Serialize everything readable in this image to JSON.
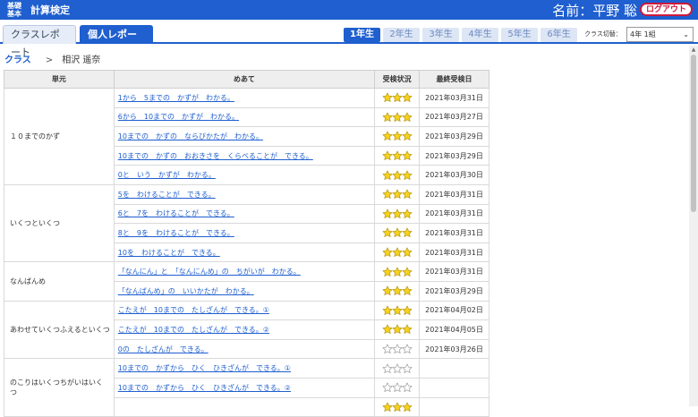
{
  "header": {
    "logo_line1": "基礎",
    "logo_line2": "基本",
    "app_title": "計算検定",
    "user_name": "名前：平野 聡",
    "logout_label": "ログアウト"
  },
  "tabs": [
    {
      "label": "クラスレポート",
      "active": false
    },
    {
      "label": "個人レポート",
      "active": true
    }
  ],
  "grade_tabs": [
    {
      "label": "1年生",
      "active": true
    },
    {
      "label": "2年生",
      "active": false
    },
    {
      "label": "3年生",
      "active": false
    },
    {
      "label": "4年生",
      "active": false
    },
    {
      "label": "5年生",
      "active": false
    },
    {
      "label": "6年生",
      "active": false
    }
  ],
  "class_switch": {
    "label": "クラス切替：",
    "value": "4年 1組"
  },
  "breadcrumb": {
    "root": "クラス",
    "separator": ">",
    "current": "相沢 遥奈"
  },
  "table": {
    "headers": [
      "単元",
      "めあて",
      "受検状況",
      "最終受検日"
    ],
    "units": [
      {
        "name": "１０までのかず",
        "rows": [
          {
            "goal": "1から　5までの　かずが　わかる。",
            "stars": 3,
            "date": "2021年03月31日"
          },
          {
            "goal": "6から　10までの　かずが　わかる。",
            "stars": 3,
            "date": "2021年03月27日"
          },
          {
            "goal": "10までの　かずの　ならびかたが　わかる。",
            "stars": 3,
            "date": "2021年03月29日"
          },
          {
            "goal": "10までの　かずの　おおきさを　くらべることが　できる。",
            "stars": 3,
            "date": "2021年03月29日"
          },
          {
            "goal": "0と　いう　かずが　わかる。",
            "stars": 3,
            "date": "2021年03月30日"
          }
        ]
      },
      {
        "name": "いくつといくつ",
        "rows": [
          {
            "goal": "5を　わけることが　できる。",
            "stars": 3,
            "date": "2021年03月31日"
          },
          {
            "goal": "6と　7を　わけることが　できる。",
            "stars": 3,
            "date": "2021年03月31日"
          },
          {
            "goal": "8と　9を　わけることが　できる。",
            "stars": 3,
            "date": "2021年03月31日"
          },
          {
            "goal": "10を　わけることが　できる。",
            "stars": 3,
            "date": "2021年03月31日"
          }
        ]
      },
      {
        "name": "なんばんめ",
        "rows": [
          {
            "goal": "「なんにん」と　「なんにんめ」の　ちがいが　わかる。",
            "stars": 3,
            "date": "2021年03月31日"
          },
          {
            "goal": "「なんばんめ」の　いいかたが　わかる。",
            "stars": 3,
            "date": "2021年03月29日"
          }
        ]
      },
      {
        "name": "あわせていくつふえるといくつ",
        "rows": [
          {
            "goal": "こたえが　10までの　たしざんが　できる。①",
            "stars": 3,
            "date": "2021年04月02日"
          },
          {
            "goal": "こたえが　10までの　たしざんが　できる。②",
            "stars": 3,
            "date": "2021年04月05日"
          },
          {
            "goal": "0の　たしざんが　できる。",
            "stars": 0,
            "date": "2021年03月26日"
          }
        ]
      },
      {
        "name": "のこりはいくつちがいはいくつ",
        "rows": [
          {
            "goal": "10までの　かずから　ひく　ひきざんが　できる。①",
            "stars": 0,
            "date": ""
          },
          {
            "goal": "10までの　かずから　ひく　ひきざんが　できる。②",
            "stars": 0,
            "date": ""
          },
          {
            "goal": "",
            "stars": 3,
            "date": ""
          }
        ]
      }
    ]
  },
  "colors": {
    "primary": "#1f5fcf",
    "star_fill": "#f5d21c",
    "star_empty": "#ffffff",
    "logout": "#d0193a"
  }
}
